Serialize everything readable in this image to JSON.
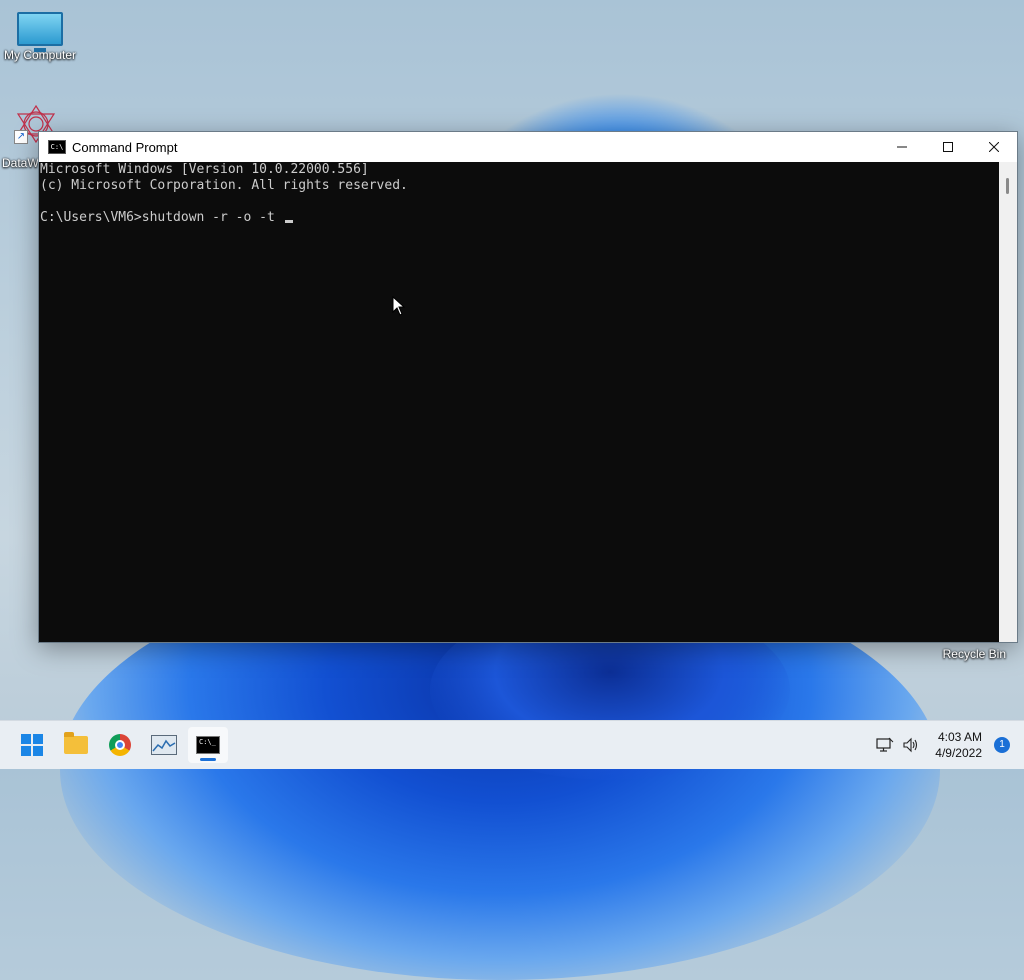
{
  "desktop": {
    "icons": [
      {
        "label": "My Computer",
        "icon": "monitor-icon"
      },
      {
        "label": "DataW",
        "icon": "datawrangler-logo-icon"
      }
    ],
    "recycle_bin_label": "Recycle Bin"
  },
  "window": {
    "title": "Command Prompt",
    "controls": {
      "minimize": "—",
      "maximize": "☐",
      "close": "✕"
    },
    "console_lines": [
      "Microsoft Windows [Version 10.0.22000.556]",
      "(c) Microsoft Corporation. All rights reserved.",
      "",
      "C:\\Users\\VM6>shutdown -r -o -t "
    ]
  },
  "taskbar": {
    "items": [
      {
        "name": "start-button",
        "icon": "windows-logo-icon"
      },
      {
        "name": "file-explorer",
        "icon": "folder-icon"
      },
      {
        "name": "chrome",
        "icon": "chrome-icon"
      },
      {
        "name": "resource-monitor",
        "icon": "monitor-chart-icon"
      },
      {
        "name": "command-prompt",
        "icon": "cmd-icon",
        "active": true
      }
    ],
    "clock": {
      "time": "4:03 AM",
      "date": "4/9/2022"
    },
    "notification_count": "1"
  },
  "colors": {
    "console_bg": "#0c0c0c",
    "console_fg": "#cccccc",
    "accent": "#1a6fd6"
  }
}
